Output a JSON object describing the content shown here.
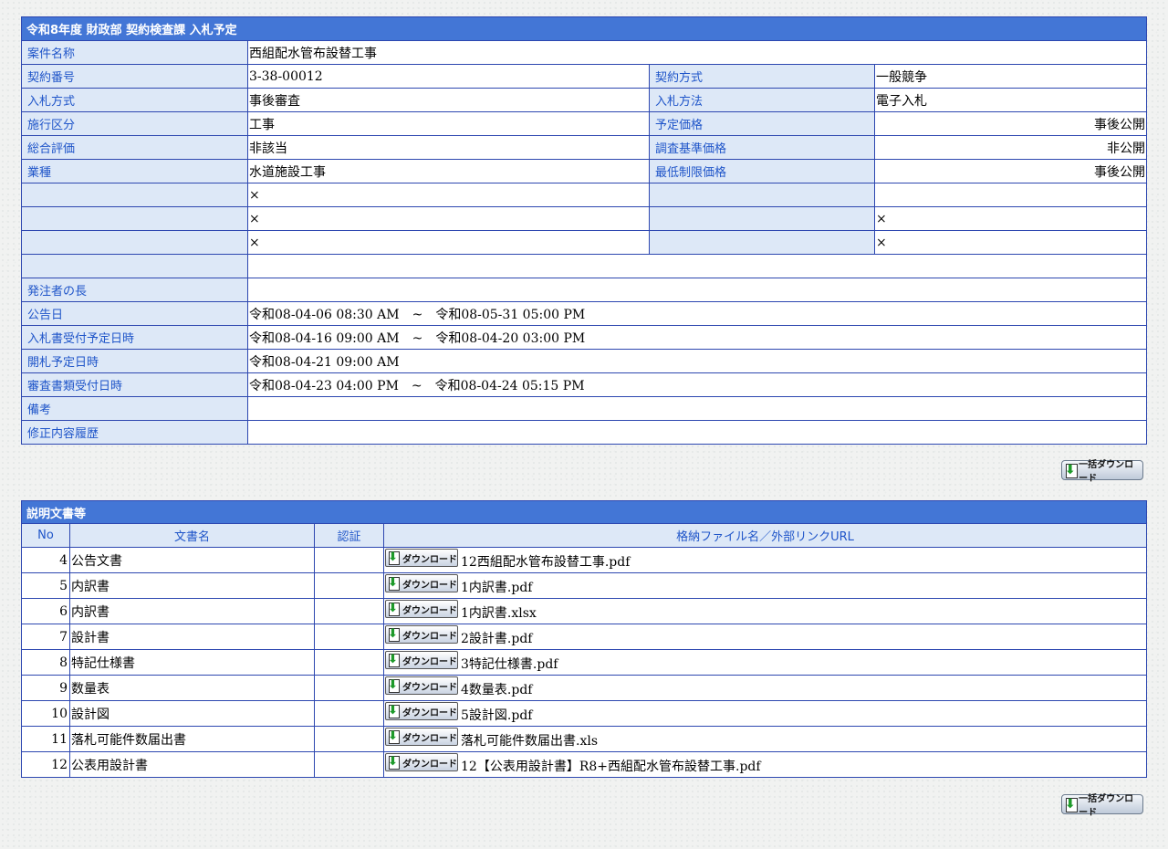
{
  "header": {
    "title": "令和8年度  財政部  契約検査課  入札予定"
  },
  "info": {
    "case_name_label": "案件名称",
    "case_name": "西組配水管布設替工事",
    "rows2": [
      {
        "l1": "契約番号",
        "v1": "3-38-00012",
        "l2": "契約方式",
        "v2": "一般競争",
        "right": false
      },
      {
        "l1": "入札方式",
        "v1": "事後審査",
        "l2": "入札方法",
        "v2": "電子入札",
        "right": false
      },
      {
        "l1": "施行区分",
        "v1": "工事",
        "l2": "予定価格",
        "v2": "事後公開",
        "right": true
      },
      {
        "l1": "総合評価",
        "v1": "非該当",
        "l2": "調査基準価格",
        "v2": "非公開",
        "right": true
      },
      {
        "l1": "業種",
        "v1": "水道施設工事",
        "l2": "最低制限価格",
        "v2": "事後公開",
        "right": true
      },
      {
        "l1": "",
        "v1": "×",
        "l2": "",
        "v2": "",
        "right": false
      },
      {
        "l1": "",
        "v1": "×",
        "l2": "",
        "v2": "×",
        "right": false
      },
      {
        "l1": "",
        "v1": "×",
        "l2": "",
        "v2": "×",
        "right": false
      }
    ],
    "rows1": [
      {
        "l": "",
        "v": ""
      },
      {
        "l": "発注者の長",
        "v": ""
      },
      {
        "l": "公告日",
        "v": "令和08-04-06 08:30 AM　~　令和08-05-31 05:00 PM"
      },
      {
        "l": "入札書受付予定日時",
        "v": "令和08-04-16 09:00 AM　~　令和08-04-20 03:00 PM"
      },
      {
        "l": "開札予定日時",
        "v": "令和08-04-21 09:00 AM"
      },
      {
        "l": "審査書類受付日時",
        "v": "令和08-04-23 04:00 PM　~　令和08-04-24 05:15 PM"
      },
      {
        "l": "備考",
        "v": ""
      },
      {
        "l": "修正内容履歴",
        "v": ""
      }
    ]
  },
  "bulk_download_label": "一括ダウンロード",
  "docs": {
    "title": "説明文書等",
    "columns": [
      "No",
      "文書名",
      "認証",
      "格納ファイル名／外部リンクURL"
    ],
    "download_label": "ダウンロード",
    "rows": [
      {
        "no": "4",
        "name": "公告文書",
        "auth": "",
        "file": "12西組配水管布設替工事.pdf"
      },
      {
        "no": "5",
        "name": "内訳書",
        "auth": "",
        "file": "1内訳書.pdf"
      },
      {
        "no": "6",
        "name": "内訳書",
        "auth": "",
        "file": "1内訳書.xlsx"
      },
      {
        "no": "7",
        "name": "設計書",
        "auth": "",
        "file": "2設計書.pdf"
      },
      {
        "no": "8",
        "name": "特記仕様書",
        "auth": "",
        "file": "3特記仕様書.pdf"
      },
      {
        "no": "9",
        "name": "数量表",
        "auth": "",
        "file": "4数量表.pdf"
      },
      {
        "no": "10",
        "name": "設計図",
        "auth": "",
        "file": "5設計図.pdf"
      },
      {
        "no": "11",
        "name": "落札可能件数届出書",
        "auth": "",
        "file": "落札可能件数届出書.xls"
      },
      {
        "no": "12",
        "name": "公表用設計書",
        "auth": "",
        "file": "12【公表用設計書】R8+西組配水管布設替工事.pdf"
      }
    ]
  },
  "colors": {
    "header_bg": "#4376d6",
    "label_bg": "#dde8f7",
    "label_text": "#1f55c9",
    "border": "#2d47b0"
  },
  "icons": {
    "download_button_icon": "download-arrow-icon"
  }
}
